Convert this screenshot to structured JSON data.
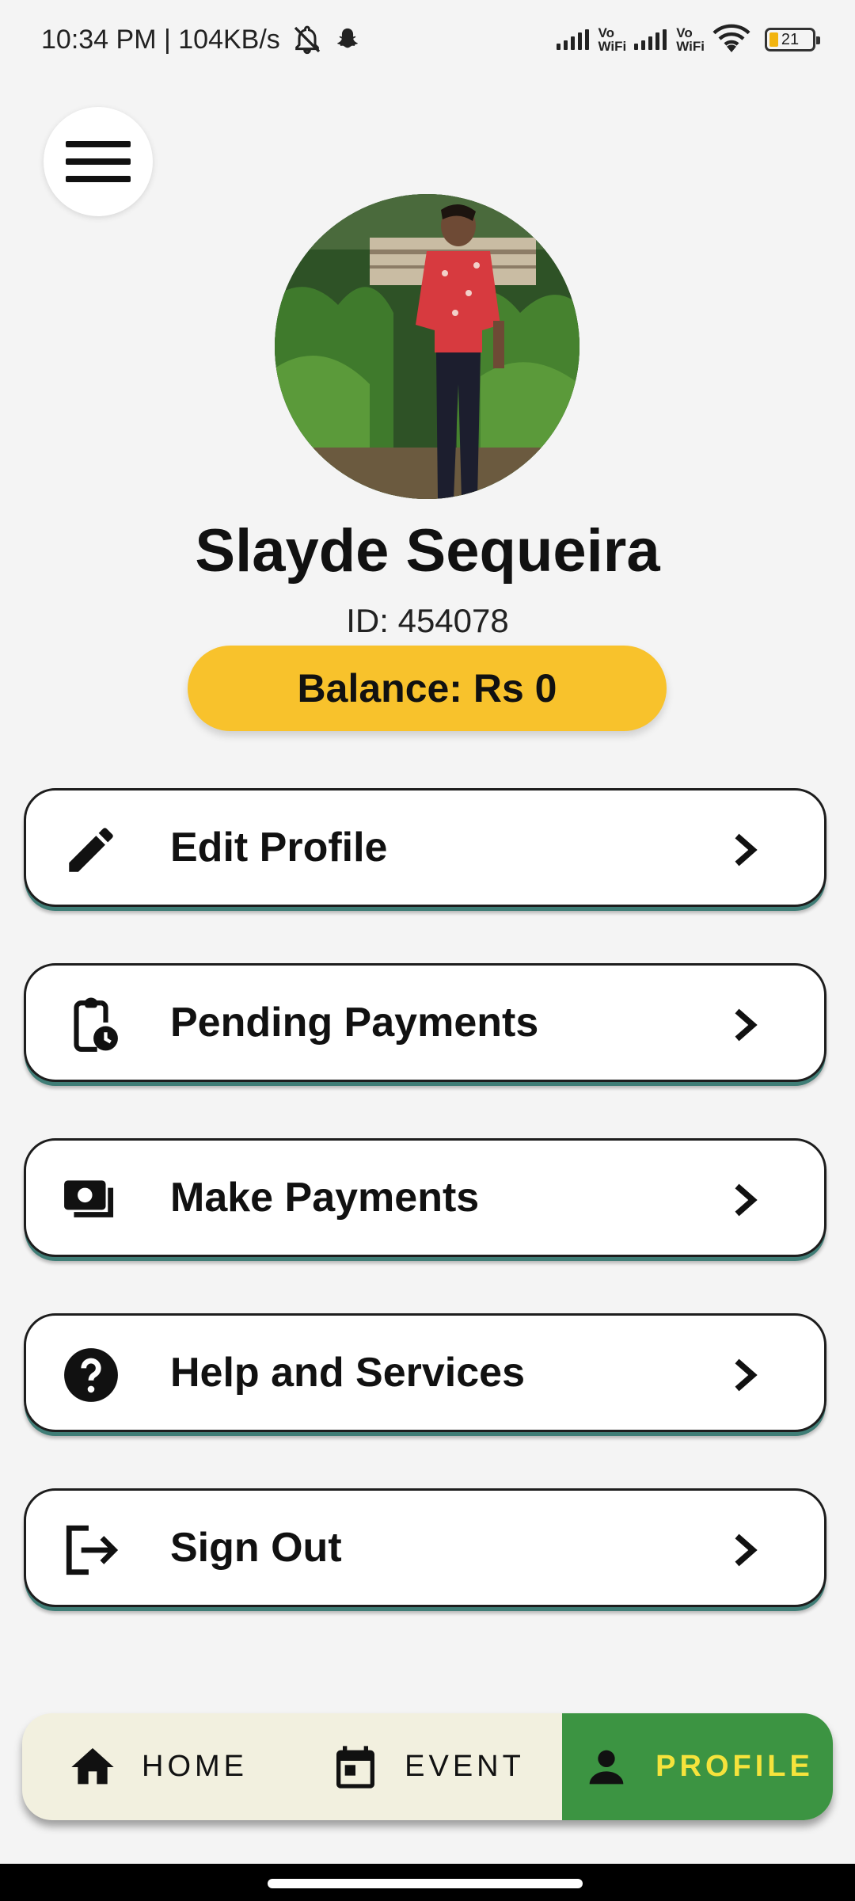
{
  "status_bar": {
    "time_speed": "10:34 PM | 104KB/s",
    "vowifi_1": [
      "Vo",
      "WiFi"
    ],
    "vowifi_2": [
      "Vo",
      "WiFi"
    ],
    "battery": "21",
    "battery_color": "#f2b40f"
  },
  "header": {
    "menu_icon": "hamburger-menu-icon"
  },
  "profile": {
    "avatar_icon": "profile-photo",
    "name": "Slayde Sequeira",
    "id_label": "ID: 454078",
    "balance_label": "Balance: Rs 0",
    "balance_color": "#f8c22c"
  },
  "menu": {
    "items": [
      {
        "label": "Edit Profile",
        "icon": "pencil-icon"
      },
      {
        "label": "Pending Payments",
        "icon": "clipboard-clock-icon"
      },
      {
        "label": "Make Payments",
        "icon": "cash-icon"
      },
      {
        "label": "Help and Services",
        "icon": "help-circle-icon"
      },
      {
        "label": "Sign Out",
        "icon": "sign-out-icon"
      }
    ],
    "chevron_icon": "chevron-right-icon"
  },
  "bottom_nav": {
    "items": [
      {
        "label": "HOME",
        "icon": "home-icon"
      },
      {
        "label": "EVENT",
        "icon": "calendar-icon"
      },
      {
        "label": "PROFILE",
        "icon": "person-icon",
        "active": true
      }
    ],
    "active_color": "#3c9442",
    "active_text_color": "#f5e33c",
    "background": "#f2f0df"
  }
}
